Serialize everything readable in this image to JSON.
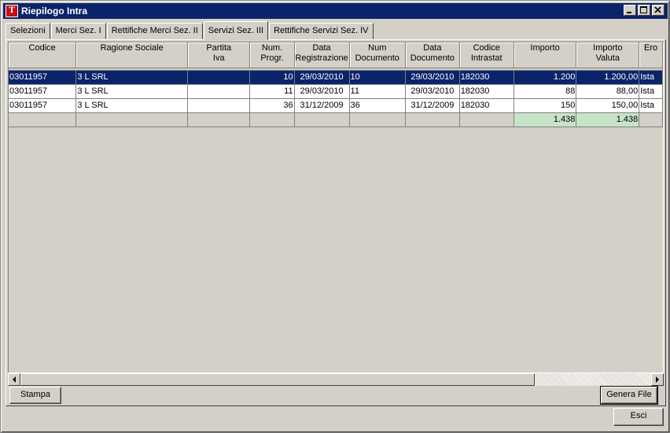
{
  "window": {
    "title": "Riepilogo Intra",
    "app_icon": "tp-app-icon"
  },
  "tabs": [
    {
      "label": "Selezioni",
      "active": false
    },
    {
      "label": "Merci Sez. I",
      "active": false
    },
    {
      "label": "Rettifiche Merci Sez. II",
      "active": false
    },
    {
      "label": "Servizi Sez. III",
      "active": true
    },
    {
      "label": "Rettifiche Servizi Sez. IV",
      "active": false
    }
  ],
  "grid": {
    "columns": [
      "Codice",
      "Ragione Sociale",
      "Partita\nIva",
      "Num.\nProgr.",
      "Data\nRegistrazione",
      "Num\nDocumento",
      "Data\nDocumento",
      "Codice\nIntrastat",
      "Importo",
      "Importo\nValuta",
      "Ero"
    ],
    "rows": [
      [
        "03011957",
        "3 L SRL",
        "",
        "10",
        "29/03/2010",
        "10",
        "29/03/2010",
        "182030",
        "1.200",
        "1.200,00",
        "Ista"
      ],
      [
        "03011957",
        "3 L SRL",
        "",
        "11",
        "29/03/2010",
        "11",
        "29/03/2010",
        "182030",
        "88",
        "88,00",
        "Ista"
      ],
      [
        "03011957",
        "3 L SRL",
        "",
        "36",
        "31/12/2009",
        "36",
        "31/12/2009",
        "182030",
        "150",
        "150,00",
        "Ista"
      ]
    ],
    "selected_row": 0,
    "totals": {
      "importo": "1.438",
      "importo_valuta": "1.438"
    }
  },
  "buttons": {
    "stampa": "Stampa",
    "genera_file": "Genera File",
    "esci": "Esci"
  },
  "colors": {
    "titlebar": "#0a246a",
    "selection": "#0a246a",
    "total_highlight": "#c8e4c8"
  }
}
